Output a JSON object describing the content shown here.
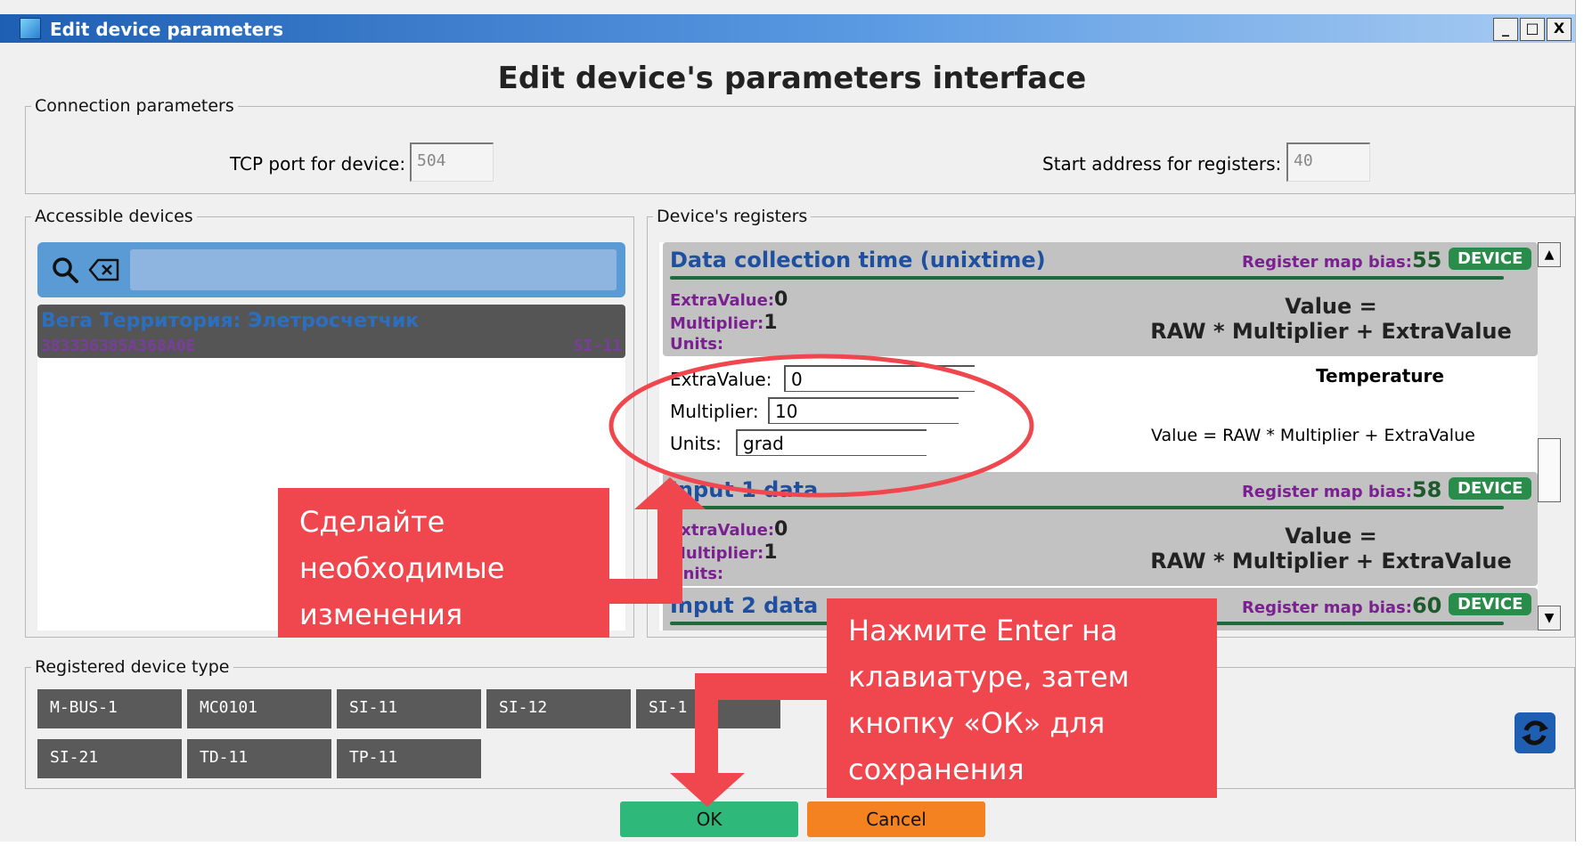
{
  "window": {
    "title": "Edit device parameters",
    "controls": [
      "_",
      "□",
      "X"
    ]
  },
  "heading": "Edit device's parameters interface",
  "connection": {
    "legend": "Connection parameters",
    "tcp_label": "TCP port for device:",
    "tcp_value": "504",
    "start_label": "Start address for registers:",
    "start_value": "40"
  },
  "accessible": {
    "legend": "Accessible devices",
    "search_placeholder": "",
    "devices": [
      {
        "name": "Вега Территория: Элетросчетчик",
        "id": "383336385A368A0E",
        "type": "SI-11"
      }
    ]
  },
  "registers": {
    "legend": "Device's registers",
    "cards": [
      {
        "title": "Data collection time (unixtime)",
        "bias_label": "Register map bias:",
        "bias": "55",
        "badge": "DEVICE",
        "extra_label": "ExtraValue:",
        "extra": "0",
        "mult_label": "Multiplier:",
        "mult": "1",
        "units_label": "Units:",
        "formula_line1": "Value =",
        "formula_line2": "RAW * Multiplier + ExtraValue"
      },
      {
        "title": "Input 1 data",
        "bias_label": "Register map bias:",
        "bias": "58",
        "badge": "DEVICE",
        "extra_label": "ExtraValue:",
        "extra": "0",
        "mult_label": "Multiplier:",
        "mult": "1",
        "units_label": "Units:",
        "formula_line1": "Value =",
        "formula_line2": "RAW * Multiplier + ExtraValue"
      },
      {
        "title": "Input 2 data",
        "bias_label": "Register map bias:",
        "bias": "60",
        "badge": "DEVICE"
      }
    ],
    "edit": {
      "extra_label": "ExtraValue:",
      "extra_value": "0",
      "mult_label": "Multiplier:",
      "mult_value": "10",
      "units_label": "Units:",
      "units_value": "grad",
      "name": "Temperature",
      "formula": "Value = RAW * Multiplier + ExtraValue"
    }
  },
  "device_types": {
    "legend": "Registered device type",
    "items": [
      "M-BUS-1",
      "MC0101",
      "SI-11",
      "SI-12",
      "SI-1",
      "SI-21",
      "TD-11",
      "TP-11"
    ]
  },
  "buttons": {
    "ok": "OK",
    "cancel": "Cancel"
  },
  "annotations": {
    "left": [
      "Сделайте",
      "необходимые",
      "изменения"
    ],
    "right": [
      "Нажмите Enter на",
      "клавиатуре, затем",
      "кнопку «ОК» для",
      "сохранения"
    ]
  },
  "colors": {
    "annotation_red": "#f0464d",
    "ok_green": "#2eb87a",
    "cancel_orange": "#f58220",
    "title_blue": "#1e4fa0",
    "device_badge": "#2a8c4a"
  },
  "icons": [
    "search-icon",
    "backspace-icon",
    "refresh-icon",
    "app-icon",
    "arrow-up-icon",
    "arrow-down-icon"
  ]
}
